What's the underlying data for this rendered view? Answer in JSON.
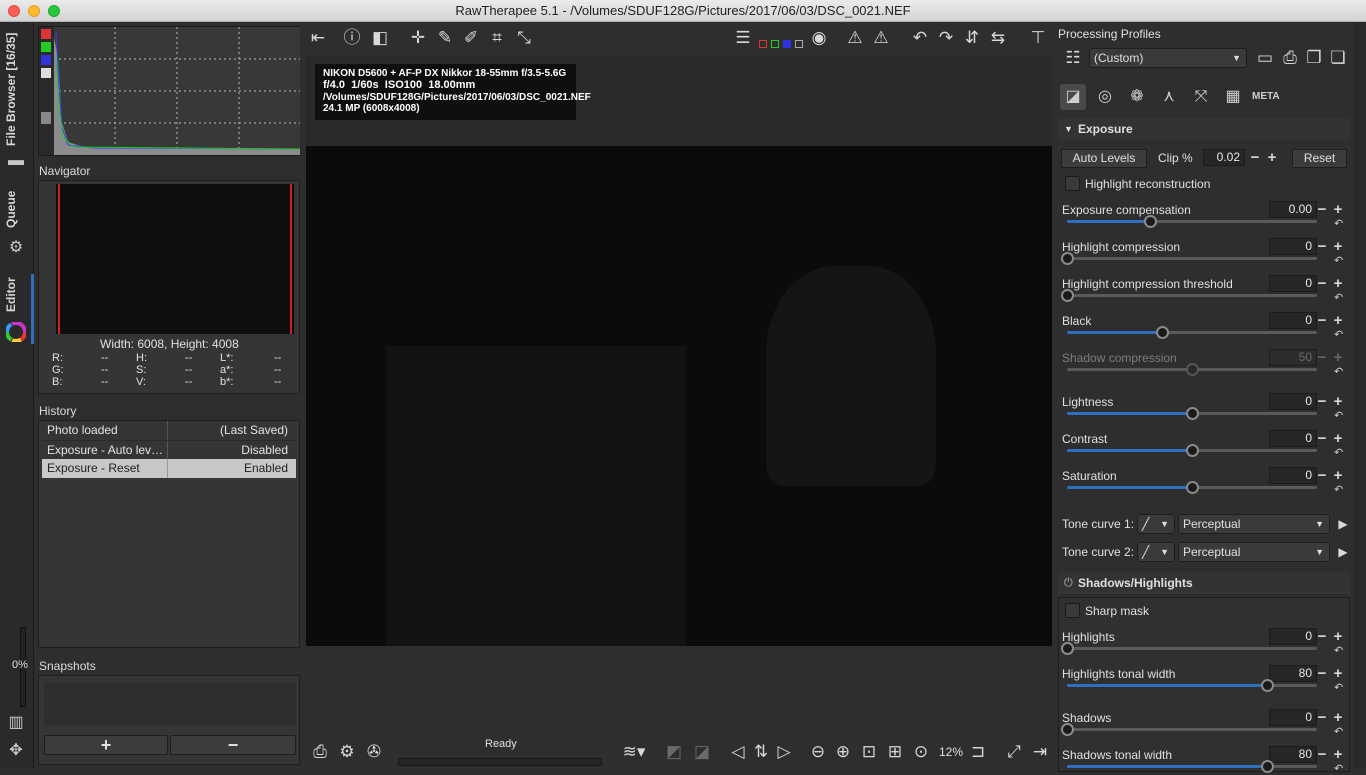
{
  "window": {
    "title": "RawTherapee 5.1 - /Volumes/SDUF128G/Pictures/2017/06/03/DSC_0021.NEF"
  },
  "vtabs": {
    "file_browser": "File Browser [16/35]",
    "queue": "Queue",
    "editor": "Editor",
    "progress": "0%"
  },
  "navigator": {
    "title": "Navigator",
    "size_text": "Width: 6008, Height: 4008",
    "r_label": "R:",
    "g_label": "G:",
    "b_label": "B:",
    "h_label": "H:",
    "s_label": "S:",
    "v_label": "V:",
    "l_label": "L*:",
    "a_label": "a*:",
    "bb_label": "b*:",
    "empty": "--"
  },
  "history": {
    "title": "History",
    "rows": [
      {
        "action": "Photo loaded",
        "value": "(Last Saved)"
      },
      {
        "action": "Exposure - Auto lev…",
        "value": "Disabled"
      },
      {
        "action": "Exposure - Reset",
        "value": "Enabled"
      }
    ]
  },
  "snapshots": {
    "title": "Snapshots",
    "add": "+",
    "remove": "−"
  },
  "exif": {
    "line1": "NIKON D5600 + AF-P DX Nikkor 18-55mm f/3.5-5.6G",
    "aperture": "f/4.0",
    "shutter": "1/60s",
    "iso": "ISO100",
    "focal": "18.00mm",
    "path": "/Volumes/SDUF128G/Pictures/2017/06/03/DSC_0021.NEF",
    "mp": "24.1 MP (6008x4008)"
  },
  "status": {
    "text": "Ready",
    "zoom": "12%"
  },
  "processing_profiles": {
    "title": "Processing Profiles",
    "selected": "(Custom)"
  },
  "exposure": {
    "title": "Exposure",
    "auto_levels": "Auto Levels",
    "clip_label": "Clip %",
    "clip_value": "0.02",
    "reset": "Reset",
    "highlight_reconstruction": "Highlight reconstruction",
    "sliders": [
      {
        "label": "Exposure compensation",
        "value": "0.00",
        "pos": 0.33,
        "fill_from_center": false
      },
      {
        "label": "Highlight compression",
        "value": "0",
        "pos": 0.0
      },
      {
        "label": "Highlight compression threshold",
        "value": "0",
        "pos": 0.0
      },
      {
        "label": "Black",
        "value": "0",
        "pos": 0.38
      },
      {
        "label": "Shadow compression",
        "value": "50",
        "pos": 0.5
      },
      {
        "label": "Lightness",
        "value": "0",
        "pos": 0.5
      },
      {
        "label": "Contrast",
        "value": "0",
        "pos": 0.5
      },
      {
        "label": "Saturation",
        "value": "0",
        "pos": 0.5
      }
    ],
    "tone_curve_1": "Tone curve 1:",
    "tone_curve_2": "Tone curve 2:",
    "tone_mode_1": "Perceptual",
    "tone_mode_2": "Perceptual"
  },
  "shadows_highlights": {
    "title": "Shadows/Highlights",
    "sharp_mask": "Sharp mask",
    "sliders": [
      {
        "label": "Highlights",
        "value": "0",
        "pos": 0.0
      },
      {
        "label": "Highlights tonal width",
        "value": "80",
        "pos": 0.8
      },
      {
        "label": "Shadows",
        "value": "0",
        "pos": 0.0
      },
      {
        "label": "Shadows tonal width",
        "value": "80",
        "pos": 0.8
      }
    ]
  },
  "colors": {
    "accent": "#2f6fbf",
    "history_selected": "#c8c8c8"
  }
}
